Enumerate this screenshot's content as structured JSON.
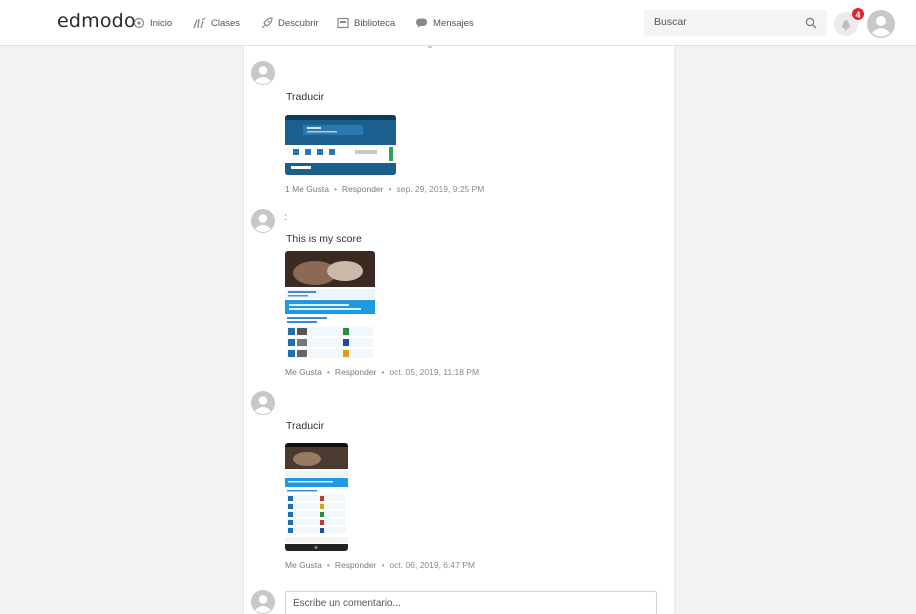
{
  "header": {
    "logo": "edmodo",
    "nav": [
      {
        "label": "Inicio",
        "icon": "home-icon"
      },
      {
        "label": "Clases",
        "icon": "classes-icon"
      },
      {
        "label": "Descubrir",
        "icon": "rocket-icon"
      },
      {
        "label": "Biblioteca",
        "icon": "library-icon"
      },
      {
        "label": "Mensajes",
        "icon": "messages-icon"
      }
    ],
    "search_placeholder": "Buscar",
    "notification_count": "4"
  },
  "posts": [
    {
      "text": "Traducir",
      "likes": "1 Me Gusta",
      "reply": "Responder",
      "date": "sep. 29, 2019, 9:25 PM"
    },
    {
      "author_mark": ":",
      "text": "This is my score",
      "likes": "Me Gusta",
      "reply": "Responder",
      "date": "oct. 05, 2019, 11:18 PM"
    },
    {
      "text": "Traducir",
      "likes": "Me Gusta",
      "reply": "Responder",
      "date": "oct. 06, 2019, 6:47 PM"
    }
  ],
  "comment": {
    "placeholder": "Escribe un comentario..."
  },
  "colors": {
    "brand_blue": "#1a7fc1",
    "badge_red": "#e0262c",
    "background": "#f2f2f2"
  }
}
